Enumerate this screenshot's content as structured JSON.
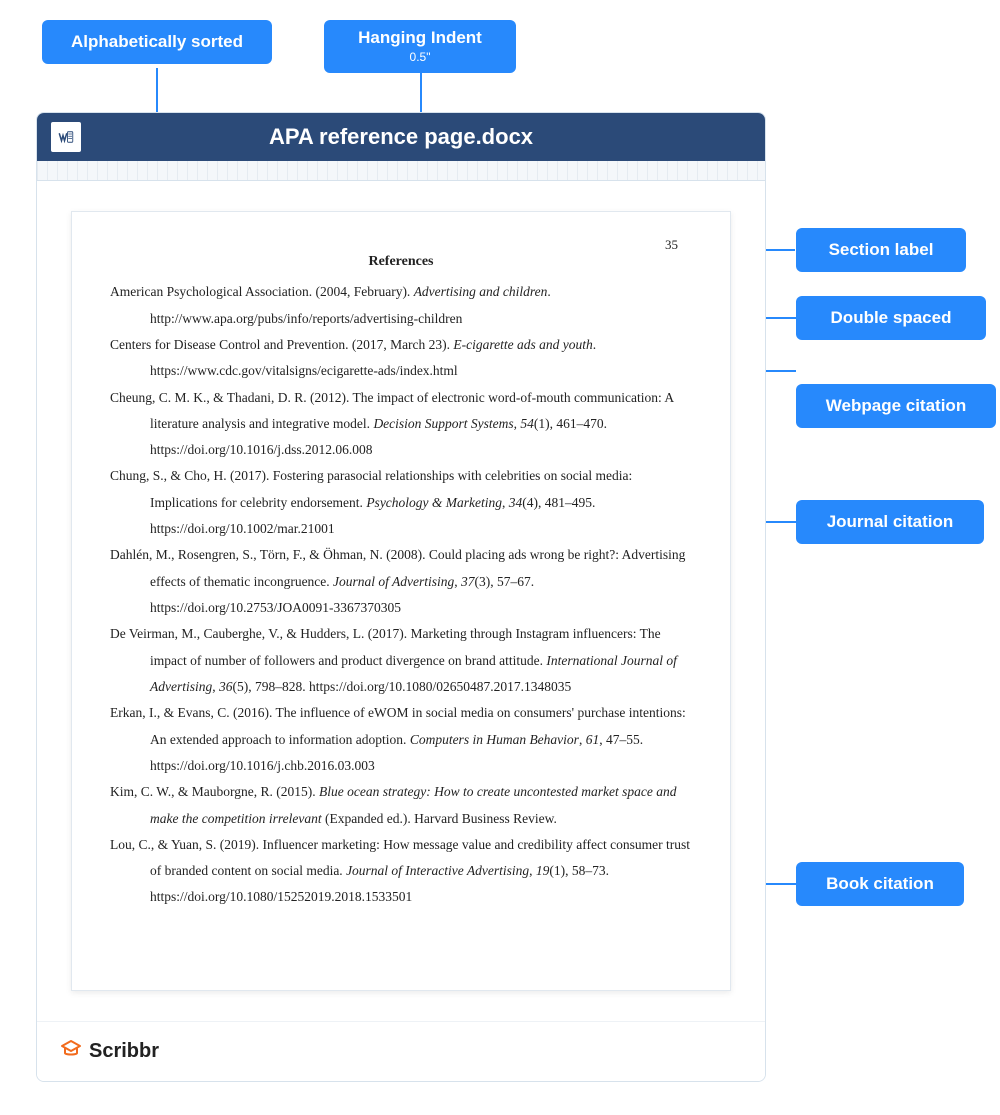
{
  "tags": {
    "alphabetical": "Alphabetically sorted",
    "hanging_indent": "Hanging Indent",
    "hanging_indent_sub": "0.5\"",
    "section_label": "Section label",
    "double_spaced": "Double spaced",
    "webpage_citation": "Webpage citation",
    "journal_citation": "Journal citation",
    "book_citation": "Book citation"
  },
  "doc": {
    "title": "APA reference page.docx",
    "page_number": "35",
    "section_heading": "References",
    "references": [
      {
        "html": "American Psychological Association. (2004, February). <i>Advertising and children</i>. http://www.apa.org/pubs/info/reports/advertising-children"
      },
      {
        "html": "Centers for Disease Control and Prevention. (2017, March 23). <i>E-cigarette ads and youth</i>. https://www.cdc.gov/vitalsigns/ecigarette-ads/index.html"
      },
      {
        "html": "Cheung, C. M. K., &amp; Thadani, D. R. (2012). The impact of electronic word-of-mouth communication: A literature analysis and integrative model. <i>Decision Support Systems</i>, <i>54</i>(1), 461–470. https://doi.org/10.1016/j.dss.2012.06.008"
      },
      {
        "html": "Chung, S., &amp; Cho, H. (2017). Fostering parasocial relationships with celebrities on social media: Implications for celebrity endorsement. <i>Psychology &amp; Marketing</i>, <i>34</i>(4), 481–495. https://doi.org/10.1002/mar.21001"
      },
      {
        "html": "Dahlén, M., Rosengren, S., Törn, F., &amp; Öhman, N. (2008). Could placing ads wrong be right?: Advertising effects of thematic incongruence. <i>Journal of Advertising</i>, <i>37</i>(3), 57–67. https://doi.org/10.2753/JOA0091-3367370305"
      },
      {
        "html": "De Veirman, M., Cauberghe, V., &amp; Hudders, L. (2017). Marketing through Instagram influencers: The impact of number of followers and product divergence on brand attitude. <i>International Journal of Advertising</i>, <i>36</i>(5), 798–828. https://doi.org/10.1080/02650487.2017.1348035"
      },
      {
        "html": "Erkan, I., &amp; Evans, C. (2016). The influence of eWOM in social media on consumers' purchase intentions: An extended approach to information adoption. <i>Computers in Human Behavior</i>, <i>61</i>, 47–55. https://doi.org/10.1016/j.chb.2016.03.003"
      },
      {
        "html": "Kim, C. W., &amp; Mauborgne, R. (2015). <i>Blue ocean strategy: How to create uncontested market space and make the competition irrelevant</i> (Expanded ed.). Harvard Business Review."
      },
      {
        "html": "Lou, C., &amp; Yuan, S. (2019). Influencer marketing: How message value and credibility affect consumer trust of branded content on social media. <i>Journal of Interactive Advertising</i>, <i>19</i>(1), 58–73. https://doi.org/10.1080/15252019.2018.1533501"
      }
    ]
  },
  "footer": {
    "logo_text": "Scribbr"
  }
}
